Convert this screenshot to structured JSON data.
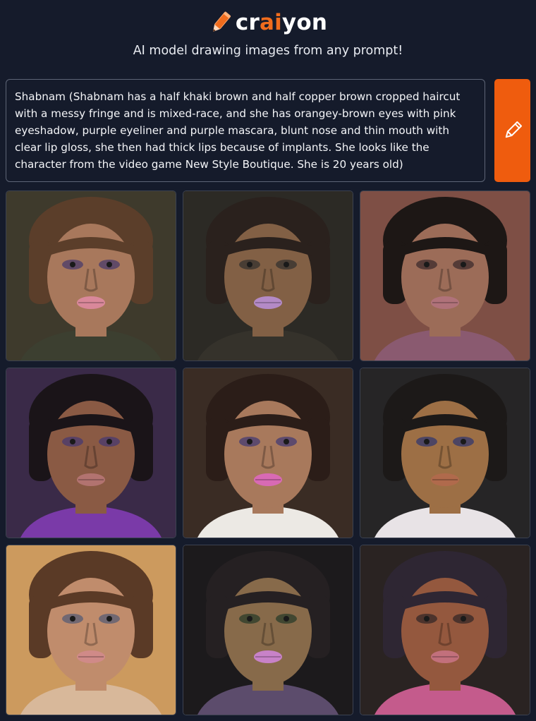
{
  "brand": {
    "name_parts": [
      "cr",
      "ai",
      "yon"
    ],
    "logo_icon": "pencil-icon",
    "accent_color": "#f06c1d"
  },
  "tagline": "AI model drawing images from any prompt!",
  "prompt": {
    "value": "Shabnam  (Shabnam has a half khaki brown and half copper brown cropped haircut with a messy fringe and is mixed-race, and she has orangey-brown eyes with pink eyeshadow, purple eyeliner and purple mascara, blunt nose and thin mouth with clear lip gloss, she then had thick lips because of implants. She looks like the character from the video game New Style Boutique. She is 20 years old)"
  },
  "draw_button": {
    "icon": "pencil-icon",
    "color": "#ef5c0e"
  },
  "results": {
    "images": [
      {
        "label": "generated-image-1",
        "bg": "#3e3a2c",
        "hair": "#5b3e2a",
        "skin": "#a8785c",
        "lips": "#d9889a",
        "clothing": "#3c3f30",
        "eyes": "#4f3f6a"
      },
      {
        "label": "generated-image-2",
        "bg": "#2c2a25",
        "hair": "#2a211d",
        "skin": "#826045",
        "lips": "#b48ac6",
        "clothing": "#35322b",
        "eyes": "#3a3530"
      },
      {
        "label": "generated-image-3",
        "bg": "#7e4f45",
        "hair": "#1d1715",
        "skin": "#9c6c58",
        "lips": "#b0727a",
        "clothing": "#8a5a70",
        "eyes": "#443030"
      },
      {
        "label": "generated-image-4",
        "bg": "#3a2a48",
        "hair": "#1a1418",
        "skin": "#8a5a44",
        "lips": "#b27370",
        "clothing": "#7a3aa8",
        "eyes": "#4b3b6e"
      },
      {
        "label": "generated-image-5",
        "bg": "#3a2c24",
        "hair": "#2b1d18",
        "skin": "#a8795c",
        "lips": "#d86ab4",
        "clothing": "#ece9e4",
        "eyes": "#4a3e72"
      },
      {
        "label": "generated-image-6",
        "bg": "#262526",
        "hair": "#1c1918",
        "skin": "#9d6f45",
        "lips": "#b06a4c",
        "clothing": "#e8e3e6",
        "eyes": "#3a3b6a"
      },
      {
        "label": "generated-image-7",
        "bg": "#cc9a5e",
        "hair": "#5a3a26",
        "skin": "#c08c6c",
        "lips": "#d08a88",
        "clothing": "#d8b89a",
        "eyes": "#5d5f74"
      },
      {
        "label": "generated-image-8",
        "bg": "#1c1a1c",
        "hair": "#252022",
        "skin": "#876a4a",
        "lips": "#c882c8",
        "clothing": "#5c4c6c",
        "eyes": "#2f3f2a"
      },
      {
        "label": "generated-image-9",
        "bg": "#2a2322",
        "hair": "#2e2633",
        "skin": "#94583e",
        "lips": "#c2707c",
        "clothing": "#c45b8c",
        "eyes": "#3a2a28"
      }
    ]
  }
}
